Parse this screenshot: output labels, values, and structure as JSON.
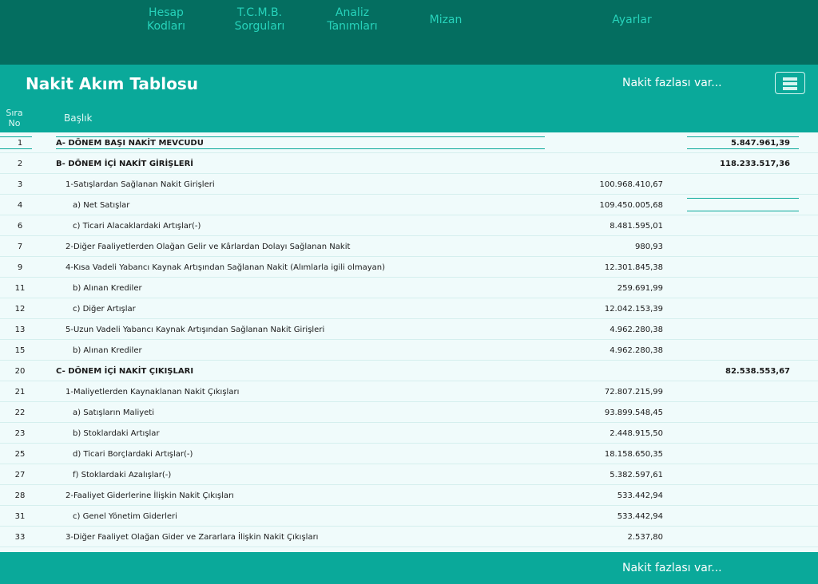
{
  "nav": {
    "hesap": [
      "Hesap",
      "Kodları"
    ],
    "tcmb": [
      "T.C.M.B.",
      "Sorguları"
    ],
    "analiz": [
      "Analiz",
      "Tanımları"
    ],
    "mizan": "Mizan",
    "ayarlar": "Ayarlar"
  },
  "header": {
    "title": "Nakit Akım Tablosu",
    "more": "Nakit fazlası var...",
    "menu_icon": "hamburger-menu-icon"
  },
  "columns": {
    "sira": [
      "Sıra",
      "No"
    ],
    "baslik": "Başlık"
  },
  "rows": [
    {
      "no": "1",
      "title": "A- DÖNEM BAŞI NAKİT MEVCUDU",
      "amount": "",
      "total": "5.847.961,39"
    },
    {
      "no": "2",
      "title": "B- DÖNEM İÇİ NAKİT GİRİŞLERİ",
      "amount": "",
      "total": "118.233.517,36"
    },
    {
      "no": "3",
      "title": "1-Satışlardan Sağlanan Nakit Girişleri",
      "amount": "100.968.410,67",
      "total": ""
    },
    {
      "no": "4",
      "title": "a) Net Satışlar",
      "amount": "109.450.005,68",
      "total": ""
    },
    {
      "no": "6",
      "title": "c) Ticari Alacaklardaki Artışlar(-)",
      "amount": "8.481.595,01",
      "total": ""
    },
    {
      "no": "7",
      "title": "2-Diğer Faaliyetlerden  Olağan Gelir ve Kârlardan Dolayı Sağlanan Nakit",
      "amount": "980,93",
      "total": ""
    },
    {
      "no": "9",
      "title": "4-Kısa Vadeli Yabancı Kaynak Artışından Sağlanan Nakit (Alımlarla igili olmayan)",
      "amount": "12.301.845,38",
      "total": ""
    },
    {
      "no": "11",
      "title": "b) Alınan Krediler",
      "amount": "259.691,99",
      "total": ""
    },
    {
      "no": "12",
      "title": "c) Diğer Artışlar",
      "amount": "12.042.153,39",
      "total": ""
    },
    {
      "no": "13",
      "title": "5-Uzun Vadeli Yabancı Kaynak Artışından Sağlanan Nakit Girişleri",
      "amount": "4.962.280,38",
      "total": ""
    },
    {
      "no": "15",
      "title": "b) Alınan Krediler",
      "amount": "4.962.280,38",
      "total": ""
    },
    {
      "no": "20",
      "title": "C- DÖNEM İÇİ NAKİT ÇIKIŞLARI",
      "amount": "",
      "total": "82.538.553,67"
    },
    {
      "no": "21",
      "title": "1-Maliyetlerden Kaynaklanan Nakit Çıkışları",
      "amount": "72.807.215,99",
      "total": ""
    },
    {
      "no": "22",
      "title": "a) Satışların Maliyeti",
      "amount": "93.899.548,45",
      "total": ""
    },
    {
      "no": "23",
      "title": "b) Stoklardaki Artışlar",
      "amount": "2.448.915,50",
      "total": ""
    },
    {
      "no": "25",
      "title": "d) Ticari Borçlardaki Artışlar(-)",
      "amount": "18.158.650,35",
      "total": ""
    },
    {
      "no": "27",
      "title": "f) Stoklardaki Azalışlar(-)",
      "amount": "5.382.597,61",
      "total": ""
    },
    {
      "no": "28",
      "title": "2-Faaliyet Giderlerine İlişkin Nakit Çıkışları",
      "amount": "533.442,94",
      "total": ""
    },
    {
      "no": "31",
      "title": "c) Genel Yönetim Giderleri",
      "amount": "533.442,94",
      "total": ""
    },
    {
      "no": "33",
      "title": "3-Diğer Faaliyet Olağan Gider ve Zararlara İlişkin Nakit Çıkışları",
      "amount": "2.537,80",
      "total": ""
    }
  ],
  "footer": {
    "more": "Nakit fazlası var..."
  },
  "colors": {
    "nav_bg": "#046e60",
    "nav_text": "#27d3bb",
    "bar_bg": "#0aa99a",
    "table_bg": "#f0fbfb"
  }
}
